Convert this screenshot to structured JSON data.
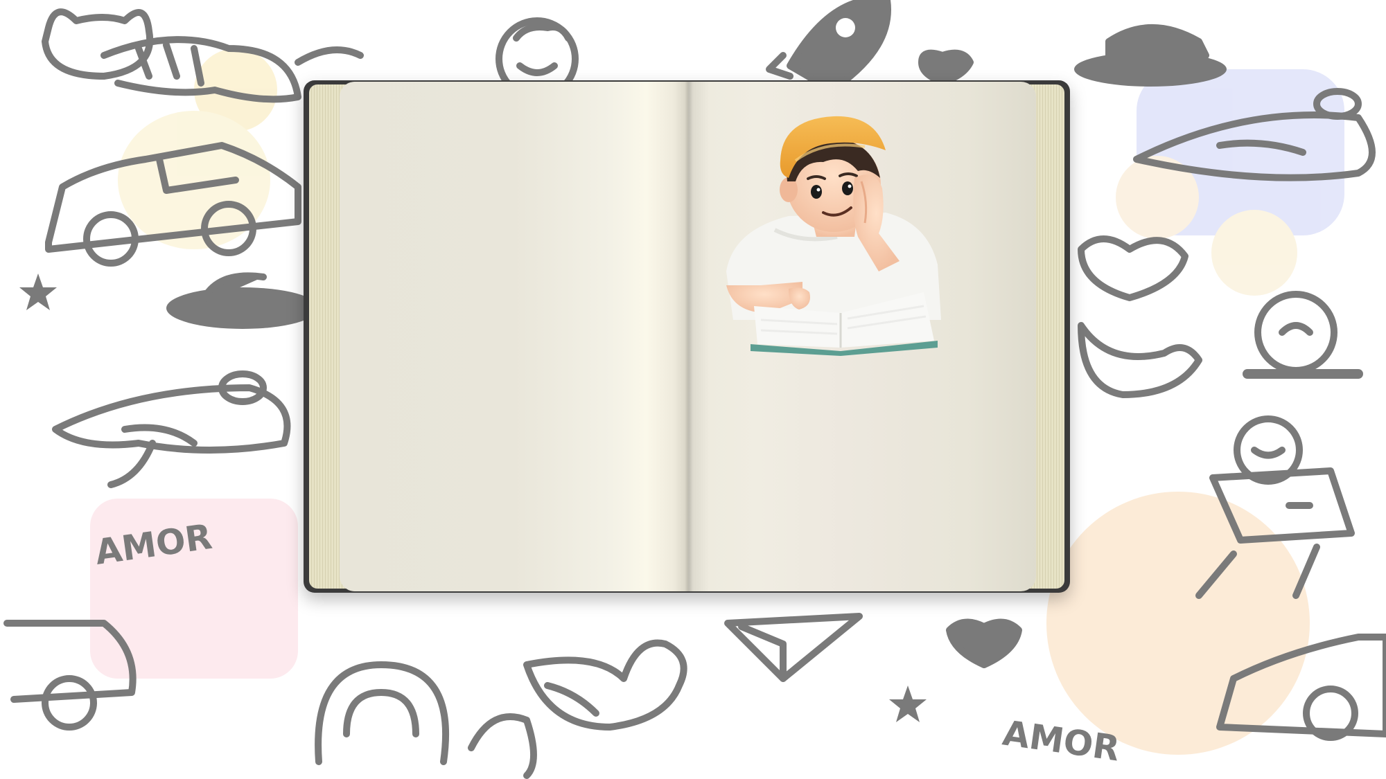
{
  "background": {
    "doodle_labels": [
      "AMOR",
      "AMOR"
    ],
    "doodle_color": "#7a7a7a"
  },
  "book": {
    "cover_color": "#3b3b3b",
    "page_color": "#ece9dd"
  },
  "illustration": {
    "subject": "boy-with-cap-reading-book",
    "cap_color": "#f0a83a",
    "shirt_color": "#f5f5f2"
  }
}
